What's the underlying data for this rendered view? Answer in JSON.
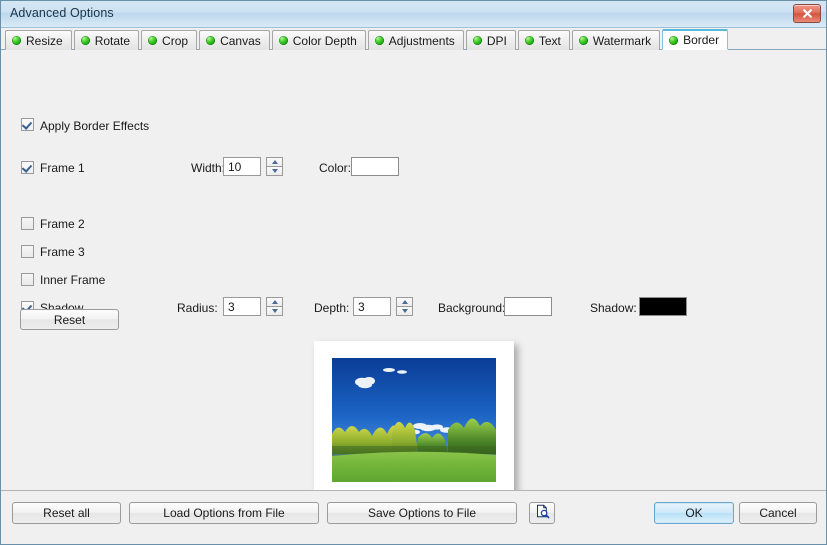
{
  "window": {
    "title": "Advanced Options",
    "close_label": "Close",
    "close_icon": "close-x-icon"
  },
  "tabs": [
    {
      "label": "Resize",
      "icon": "green-bullet-icon",
      "active": false
    },
    {
      "label": "Rotate",
      "icon": "green-bullet-icon",
      "active": false
    },
    {
      "label": "Crop",
      "icon": "green-bullet-icon",
      "active": false
    },
    {
      "label": "Canvas",
      "icon": "green-bullet-icon",
      "active": false
    },
    {
      "label": "Color Depth",
      "icon": "green-bullet-icon",
      "active": false
    },
    {
      "label": "Adjustments",
      "icon": "green-bullet-icon",
      "active": false
    },
    {
      "label": "DPI",
      "icon": "green-bullet-icon",
      "active": false
    },
    {
      "label": "Text",
      "icon": "green-bullet-icon",
      "active": false
    },
    {
      "label": "Watermark",
      "icon": "green-bullet-icon",
      "active": false
    },
    {
      "label": "Border",
      "icon": "green-bullet-icon",
      "active": true
    }
  ],
  "border_panel": {
    "apply_border_effects": {
      "label": "Apply Border Effects",
      "checked": true
    },
    "frame1": {
      "label": "Frame 1",
      "checked": true
    },
    "frame2": {
      "label": "Frame 2",
      "checked": false
    },
    "frame3": {
      "label": "Frame 3",
      "checked": false
    },
    "inner_frame": {
      "label": "Inner Frame",
      "checked": false
    },
    "shadow": {
      "label": "Shadow",
      "checked": true
    },
    "width": {
      "label": "Width:",
      "value": "10"
    },
    "color": {
      "label": "Color:",
      "value": "#ffffff"
    },
    "radius": {
      "label": "Radius:",
      "value": "3"
    },
    "depth": {
      "label": "Depth:",
      "value": "3"
    },
    "background": {
      "label": "Background:",
      "value": "#ffffff"
    },
    "shadow_color": {
      "label": "Shadow:",
      "value": "#000000"
    },
    "reset_label": "Reset",
    "spinner_up_icon": "spinner-up-arrow-icon",
    "spinner_down_icon": "spinner-down-arrow-icon"
  },
  "preview": {
    "name": "border-preview-image",
    "description": "Photo of a green meadow with trees under a deep blue sky, shown with a white frame and drop shadow"
  },
  "footer": {
    "reset_all": "Reset all",
    "load_options": "Load Options from File",
    "save_options": "Save Options to File",
    "preview_icon": "document-magnifier-preview-icon",
    "ok": "OK",
    "cancel": "Cancel"
  },
  "colors": {
    "titlebar_accent": "#bcd7ec",
    "active_tab_accent": "#5bb8dd",
    "bullet_green": "#18aa11",
    "close_red": "#d4503b",
    "default_button_blue": "#b6dff6"
  }
}
